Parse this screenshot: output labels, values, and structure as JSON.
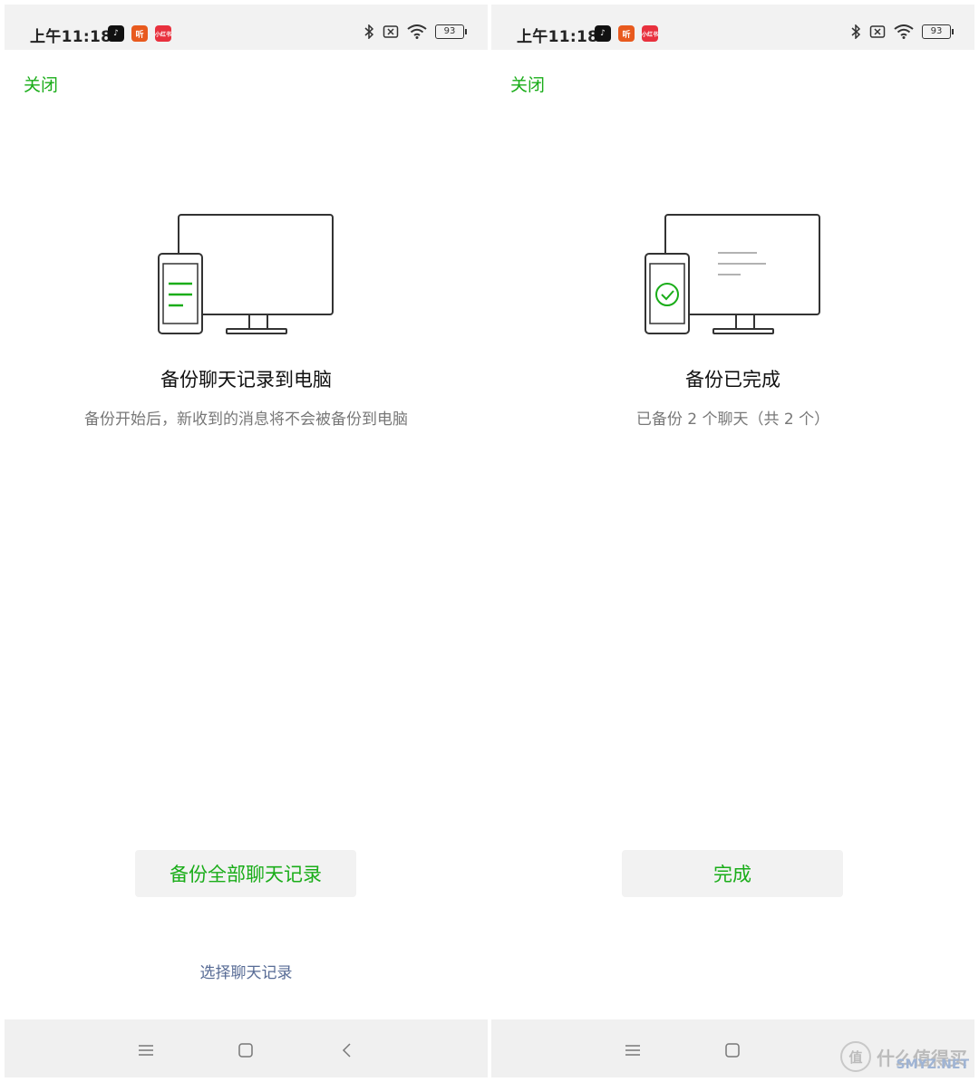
{
  "status_bar": {
    "time": "上午11:18",
    "battery": "93",
    "app_icons": [
      {
        "name": "tiktok-icon",
        "glyph": "♪",
        "color": "#111111"
      },
      {
        "name": "listen-app-icon",
        "glyph": "听",
        "color": "#e85a1e"
      },
      {
        "name": "xiaohongshu-icon",
        "glyph": "小红书",
        "color": "#e8313e"
      }
    ],
    "icons": [
      "bluetooth-icon",
      "no-sim-icon",
      "wifi-icon",
      "battery-icon"
    ]
  },
  "colors": {
    "accent": "#1aad19",
    "link": "#576b95",
    "button_bg": "#f2f2f2"
  },
  "left_screen": {
    "close_label": "关闭",
    "title": "备份聊天记录到电脑",
    "subtitle": "备份开始后，新收到的消息将不会被备份到电脑",
    "primary_button": "备份全部聊天记录",
    "secondary_link": "选择聊天记录"
  },
  "right_screen": {
    "close_label": "关闭",
    "title": "备份已完成",
    "subtitle": "已备份 2 个聊天（共 2 个）",
    "primary_button": "完成"
  },
  "nav_bar": {
    "buttons": [
      "menu-icon",
      "home-icon",
      "back-icon"
    ]
  },
  "watermark": {
    "logo": "值",
    "text": "什么值得买",
    "overlay": "SMYZ.NET"
  }
}
